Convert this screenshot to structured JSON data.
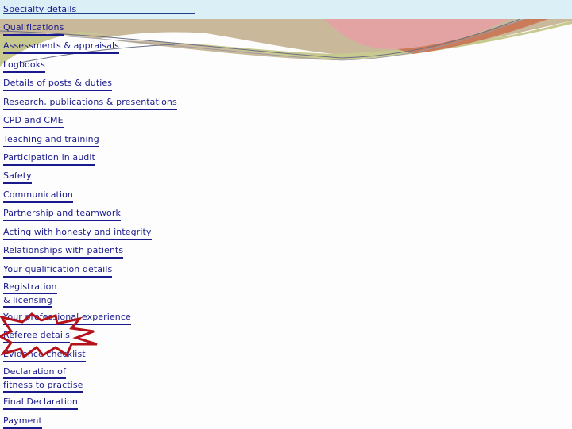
{
  "header": {
    "title_link": "Specialty details"
  },
  "nav": {
    "items": [
      {
        "label": "Qualifications"
      },
      {
        "label": "Assessments & appraisals"
      },
      {
        "label": "Logbooks"
      },
      {
        "label": "Details of posts & duties"
      },
      {
        "label": "Research, publications & presentations"
      },
      {
        "label": "CPD and CME"
      },
      {
        "label": "Teaching and training"
      },
      {
        "label": "Participation in audit"
      },
      {
        "label": "Safety"
      },
      {
        "label": "Communication"
      },
      {
        "label": "Partnership and teamwork"
      },
      {
        "label": "Acting with honesty and integrity"
      },
      {
        "label": "Relationships with patients"
      },
      {
        "label": "Your qualification details"
      },
      {
        "label_line1": "Registration ",
        "label_line2": "& licensing"
      },
      {
        "label": "Your professional experience"
      },
      {
        "label": "Referee details"
      },
      {
        "label": "Evidence checklist"
      },
      {
        "label_line1": "Declaration of",
        "label_line2": "fitness to practise"
      },
      {
        "label": "Final Declaration"
      },
      {
        "label": "Payment"
      }
    ]
  },
  "highlight": {
    "icon": "starburst-highlight-icon",
    "target": "Referee details",
    "color": "#b5121b"
  },
  "colors": {
    "link": "#1a1a8c",
    "header_band": "#dbeff6",
    "swoosh_tan": "#c9b99a",
    "swoosh_green": "#c8c98f",
    "swoosh_pink": "#e3a3a3",
    "swoosh_rust": "#c97b5a"
  }
}
